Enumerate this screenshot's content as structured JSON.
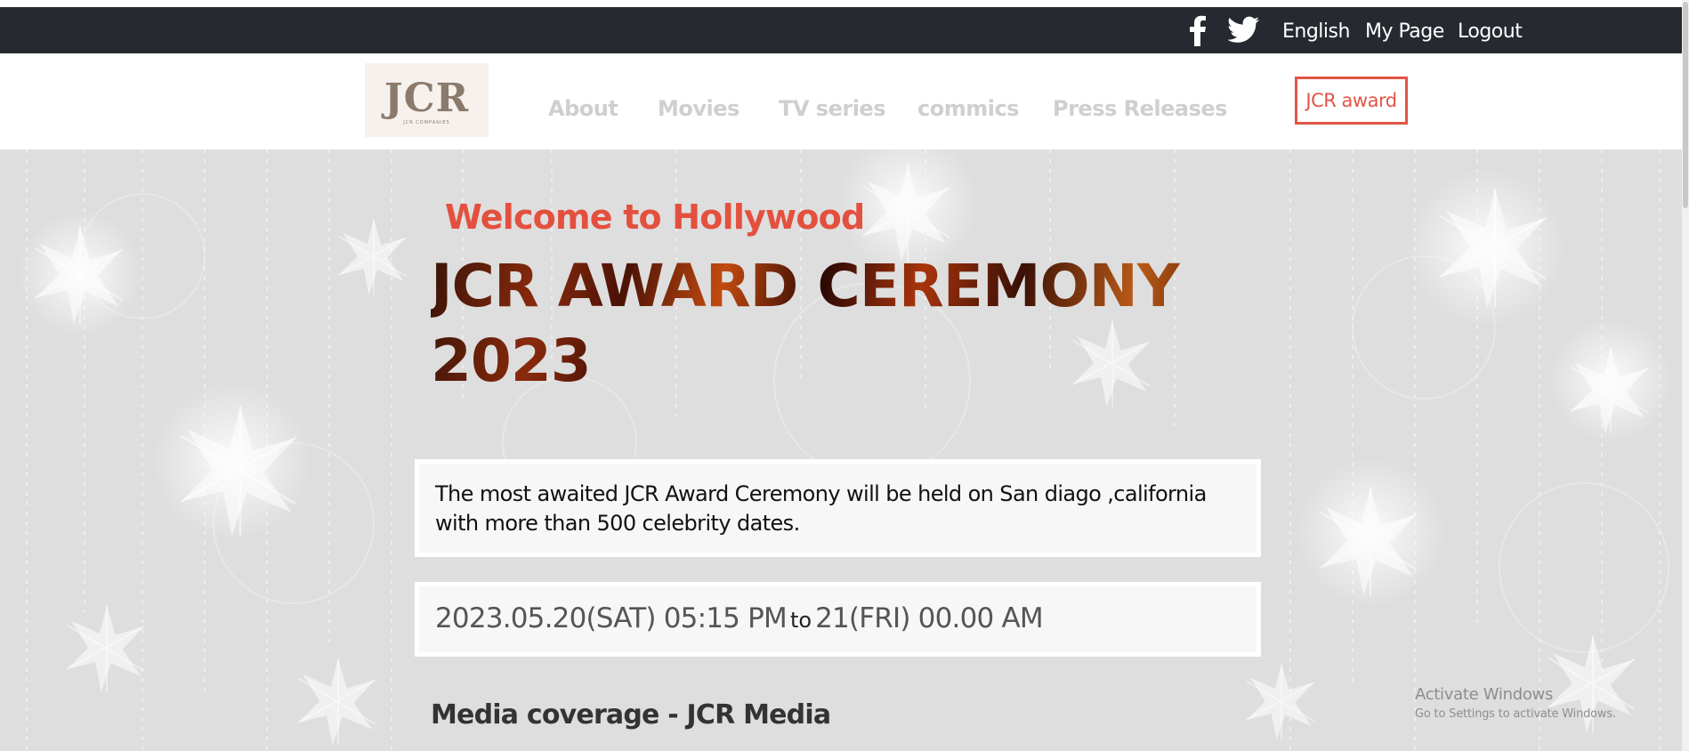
{
  "topbar": {
    "icons": [
      "facebook-icon",
      "twitter-icon"
    ],
    "links": [
      "English",
      "My Page",
      "Logout"
    ]
  },
  "navbar": {
    "logo_text": "JCR",
    "logo_subtext": "JCR COMPANIES",
    "links": [
      "About",
      "Movies",
      "TV series",
      "commics",
      "Press Releases"
    ],
    "award_button": "JCR award"
  },
  "hero": {
    "welcome": "Welcome to Hollywood",
    "title": "JCR AWARD CEREMONY 2023",
    "description": "The most awaited JCR Award Ceremony will be held on San diago ,california with more than 500 celebrity dates.",
    "date_start": "2023.05.20(SAT) 05:15 PM",
    "date_to": "to",
    "date_end": "21(FRI) 00.00 AM",
    "media_heading": "Media coverage - JCR Media"
  },
  "os_watermark": {
    "line1": "Activate Windows",
    "line2": "Go to Settings to activate Windows."
  },
  "colors": {
    "topbar_bg": "#262930",
    "accent": "#e25545",
    "nav_link": "#cfcfcf",
    "hero_bg": "#e0e0e0"
  }
}
